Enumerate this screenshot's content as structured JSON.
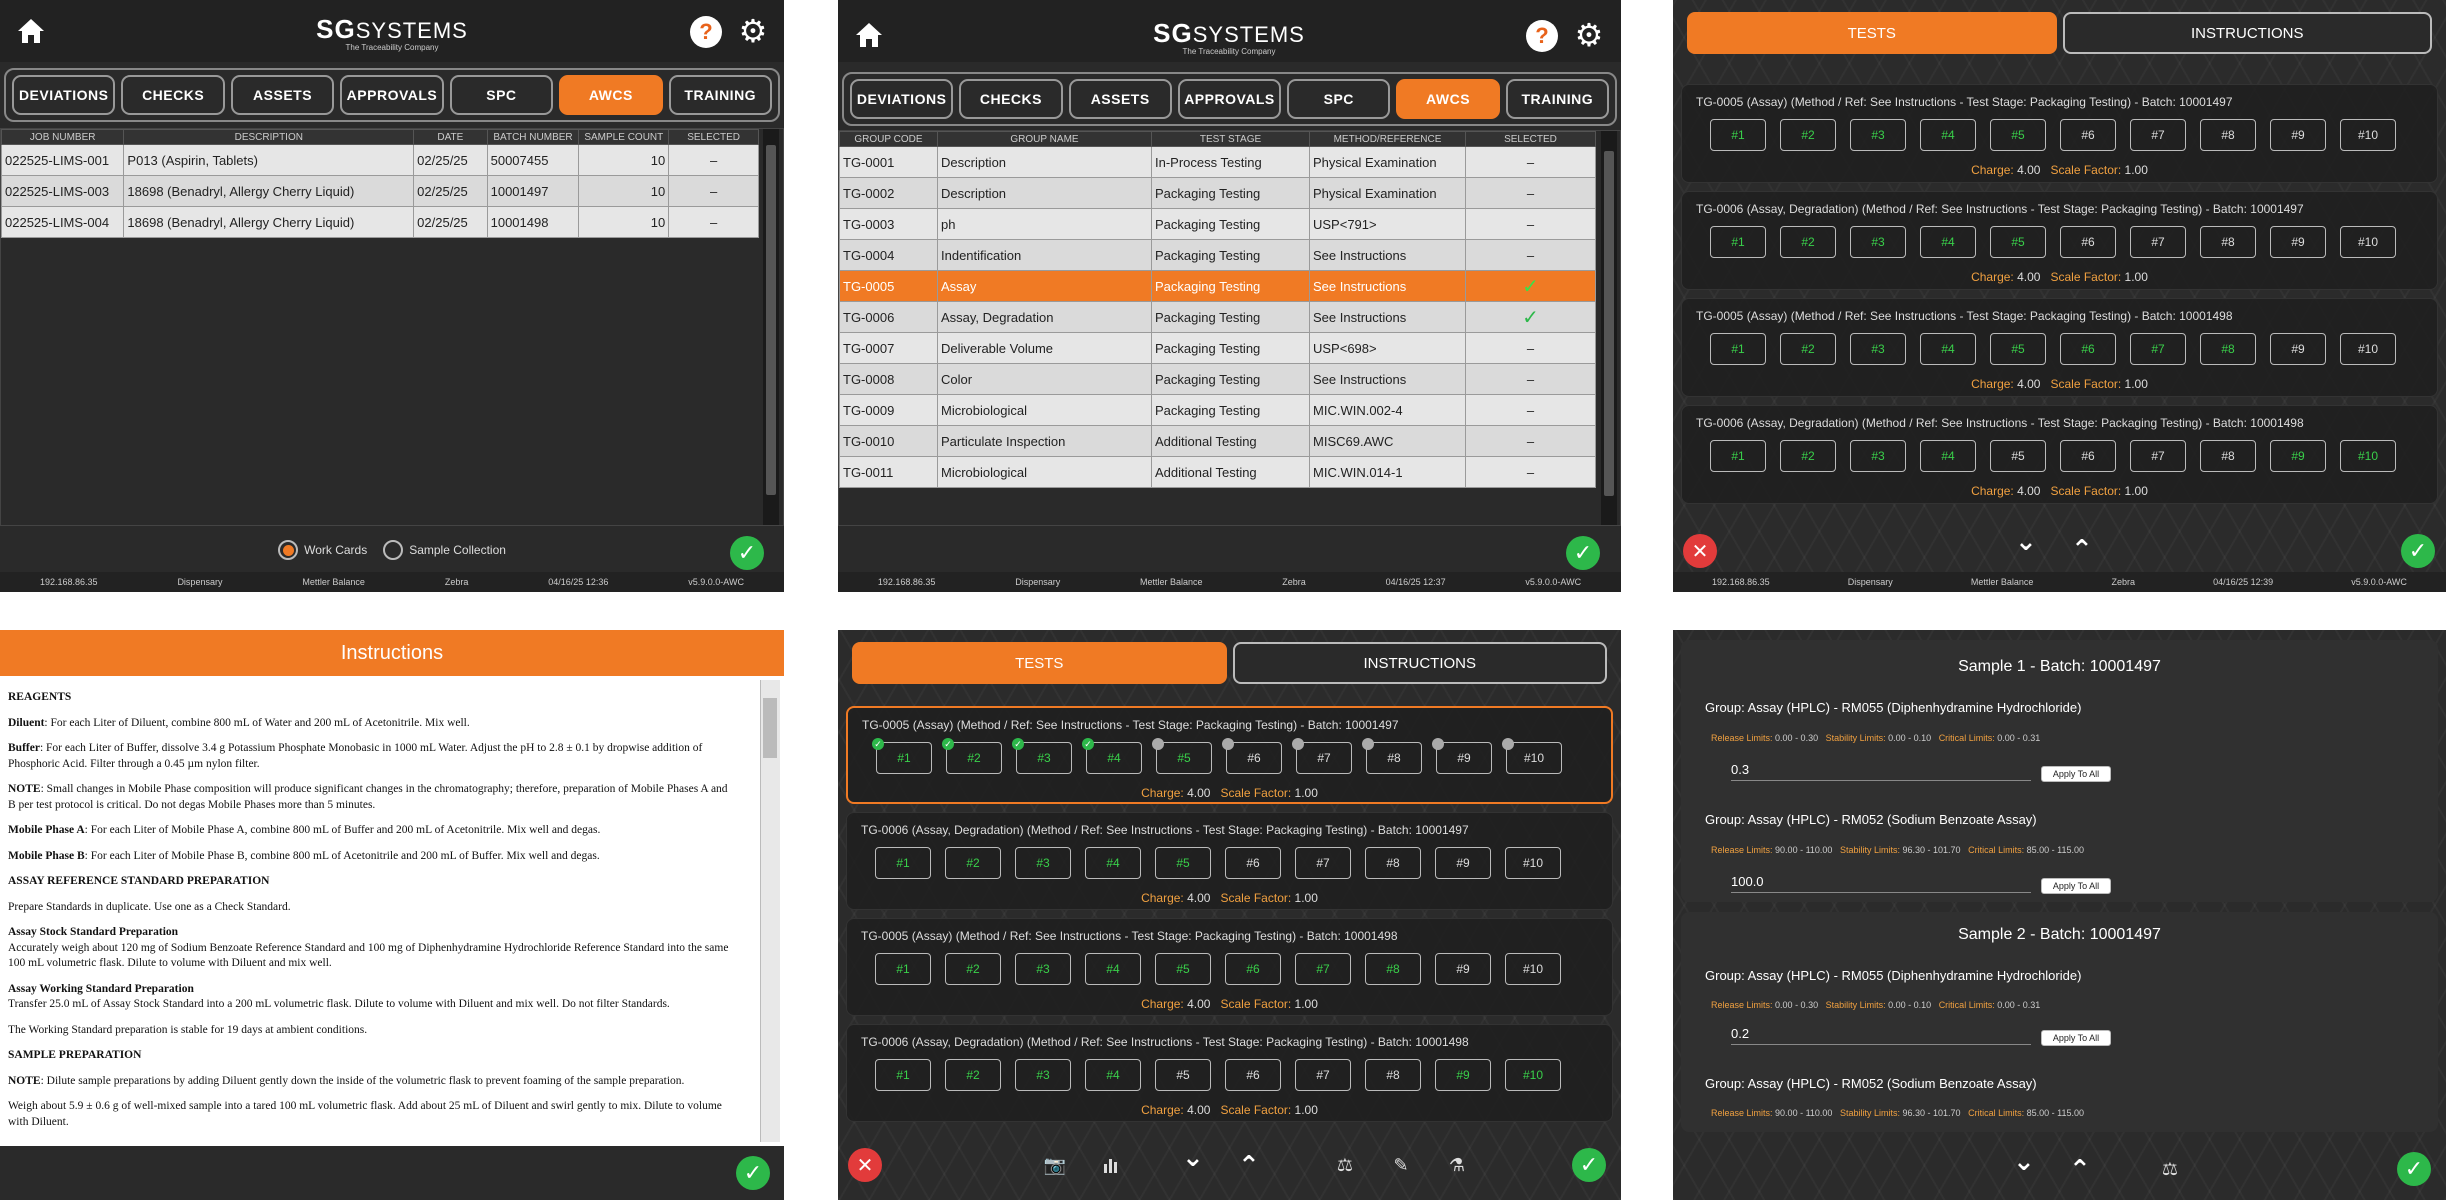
{
  "logo": {
    "mark": "SG",
    "name": "SYSTEMS",
    "tagline": "The Traceability Company"
  },
  "nav": [
    "DEVIATIONS",
    "CHECKS",
    "ASSETS",
    "APPROVALS",
    "SPC",
    "AWCS",
    "TRAINING"
  ],
  "status1": [
    "192.168.86.35",
    "Dispensary",
    "Mettler Balance",
    "Zebra",
    "04/16/25 12:36",
    "v5.9.0.0-AWC"
  ],
  "status2": [
    "192.168.86.35",
    "Dispensary",
    "Mettler Balance",
    "Zebra",
    "04/16/25 12:37",
    "v5.9.0.0-AWC"
  ],
  "status3": [
    "192.168.86.35",
    "Dispensary",
    "Mettler Balance",
    "Zebra",
    "04/16/25 12:39",
    "v5.9.0.0-AWC"
  ],
  "jobs": {
    "headers": [
      "JOB NUMBER",
      "DESCRIPTION",
      "DATE",
      "BATCH NUMBER",
      "SAMPLE COUNT",
      "SELECTED"
    ],
    "rows": [
      [
        "022525-LIMS-001",
        "P013 (Aspirin, Tablets)",
        "02/25/25",
        "50007455",
        "10",
        "–"
      ],
      [
        "022525-LIMS-003",
        "18698 (Benadryl, Allergy Cherry Liquid)",
        "02/25/25",
        "10001497",
        "10",
        "–"
      ],
      [
        "022525-LIMS-004",
        "18698 (Benadryl, Allergy Cherry Liquid)",
        "02/25/25",
        "10001498",
        "10",
        "–"
      ]
    ]
  },
  "radios": {
    "work_cards": "Work Cards",
    "sample_collection": "Sample Collection"
  },
  "groups": {
    "headers": [
      "GROUP CODE",
      "GROUP NAME",
      "TEST STAGE",
      "METHOD/REFERENCE",
      "SELECTED"
    ],
    "rows": [
      [
        "TG-0001",
        "Description",
        "In-Process Testing",
        "Physical Examination",
        "–"
      ],
      [
        "TG-0002",
        "Description",
        "Packaging Testing",
        "Physical Examination",
        "–"
      ],
      [
        "TG-0003",
        "ph",
        "Packaging Testing",
        "USP<791>",
        "–"
      ],
      [
        "TG-0004",
        "Indentification",
        "Packaging Testing",
        "See Instructions",
        "–"
      ],
      [
        "TG-0005",
        "Assay",
        "Packaging Testing",
        "See Instructions",
        "✓"
      ],
      [
        "TG-0006",
        "Assay, Degradation",
        "Packaging Testing",
        "See Instructions",
        "✓"
      ],
      [
        "TG-0007",
        "Deliverable Volume",
        "Packaging Testing",
        "USP<698>",
        "–"
      ],
      [
        "TG-0008",
        "Color",
        "Packaging Testing",
        "See Instructions",
        "–"
      ],
      [
        "TG-0009",
        "Microbiological",
        "Packaging Testing",
        "MIC.WIN.002-4",
        "–"
      ],
      [
        "TG-0010",
        "Particulate Inspection",
        "Additional Testing",
        "MISC69.AWC",
        "–"
      ],
      [
        "TG-0011",
        "Microbiological",
        "Additional Testing",
        "MIC.WIN.014-1",
        "–"
      ]
    ]
  },
  "tabs": {
    "tests": "TESTS",
    "instructions": "INSTRUCTIONS"
  },
  "sample_labels": [
    "#1",
    "#2",
    "#3",
    "#4",
    "#5",
    "#6",
    "#7",
    "#8",
    "#9",
    "#10"
  ],
  "charge_label": "Charge:",
  "scale_label": "Scale Factor:",
  "cards3": [
    {
      "title": "TG-0005 (Assay) (Method / Ref: See Instructions - Test Stage: Packaging Testing) - Batch: 10001497",
      "done": 5,
      "charge": "4.00",
      "scale": "1.00"
    },
    {
      "title": "TG-0006 (Assay, Degradation) (Method / Ref: See Instructions - Test Stage: Packaging Testing) - Batch: 10001497",
      "done": 5,
      "charge": "4.00",
      "scale": "1.00"
    },
    {
      "title": "TG-0005 (Assay) (Method / Ref: See Instructions - Test Stage: Packaging Testing) - Batch: 10001498",
      "done": 8,
      "charge": "4.00",
      "scale": "1.00"
    },
    {
      "title": "TG-0006 (Assay, Degradation) (Method / Ref: See Instructions - Test Stage: Packaging Testing) - Batch: 10001498",
      "done": 4,
      "extra": [
        8,
        9
      ],
      "charge": "4.00",
      "scale": "1.00"
    }
  ],
  "cards5": [
    {
      "title": "TG-0005 (Assay) (Method / Ref: See Instructions - Test Stage: Packaging Testing) - Batch: 10001497",
      "done": 5,
      "charge": "4.00",
      "scale": "1.00"
    },
    {
      "title": "TG-0006 (Assay, Degradation) (Method / Ref: See Instructions - Test Stage: Packaging Testing) - Batch: 10001497",
      "done": 5,
      "charge": "4.00",
      "scale": "1.00"
    },
    {
      "title": "TG-0005 (Assay) (Method / Ref: See Instructions - Test Stage: Packaging Testing) - Batch: 10001498",
      "done": 8,
      "charge": "4.00",
      "scale": "1.00"
    },
    {
      "title": "TG-0006 (Assay, Degradation) (Method / Ref: See Instructions - Test Stage: Packaging Testing) - Batch: 10001498",
      "done": 4,
      "extra": [
        8,
        9
      ],
      "charge": "4.00",
      "scale": "1.00"
    }
  ],
  "instructions": {
    "title": "Instructions",
    "h_reagents": "REAGENTS",
    "diluent_k": "Diluent",
    "diluent_v": ": For each Liter of Diluent, combine 800 mL of Water and 200 mL of Acetonitrile. Mix well.",
    "buffer_k": "Buffer",
    "buffer_v": ": For each Liter of Buffer, dissolve 3.4 g Potassium Phosphate Monobasic in 1000 mL Water. Adjust the pH to 2.8 ± 0.1 by dropwise addition of Phosphoric Acid. Filter through a 0.45 µm nylon filter.",
    "note_k": "NOTE",
    "note_v": ": Small changes in Mobile Phase composition will produce significant changes in the chromatography; therefore, preparation of Mobile Phases A and B per test protocol is critical. Do not degas Mobile Phases more than 5 minutes.",
    "mpa_k": "Mobile Phase A",
    "mpa_v": ": For each Liter of Mobile Phase A, combine 800 mL of Buffer and 200 mL of Acetonitrile. Mix well and degas.",
    "mpb_k": "Mobile Phase B",
    "mpb_v": ": For each Liter of Mobile Phase B, combine 800 mL of Acetonitrile and 200 mL of Buffer. Mix well and degas.",
    "h_assay": "ASSAY REFERENCE STANDARD PREPARATION",
    "dup": "Prepare Standards in duplicate. Use one as a Check Standard.",
    "stock_k": "Assay Stock Standard Preparation",
    "stock_v": "Accurately weigh about 120 mg of Sodium Benzoate Reference Standard and 100 mg of Diphenhydramine Hydrochloride Reference Standard into the same 100 mL volumetric flask. Dilute to volume with Diluent and mix well.",
    "work_k": "Assay Working Standard Preparation",
    "work_v": "Transfer 25.0 mL of Assay Stock Standard into a 200 mL volumetric flask. Dilute to volume with Diluent and mix well. Do not filter Standards.",
    "stable": "The Working Standard preparation is stable for 19 days at ambient conditions.",
    "h_sample": "SAMPLE PREPARATION",
    "note2_k": "NOTE",
    "note2_v": ": Dilute sample preparations by adding Diluent gently down the inside of the volumetric flask to prevent foaming of the sample preparation.",
    "weigh": "Weigh about 5.9 ± 0.6 g of well-mixed sample into a tared 100 mL volumetric flask. Add about 25 mL of Diluent and swirl gently to mix. Dilute to volume with Diluent."
  },
  "results": {
    "s1": "Sample 1 - Batch: 10001497",
    "s2": "Sample 2 - Batch: 10001497",
    "g_rm055": "Group: Assay (HPLC) - RM055 (Diphenhydramine Hydrochloride)",
    "g_rm052": "Group: Assay (HPLC) - RM052 (Sodium Benzoate Assay)",
    "rel_k": "Release Limits:",
    "stab_k": "Stability Limits:",
    "crit_k": "Critical Limits:",
    "rm055_rel": "0.00 - 0.30",
    "rm055_stab": "0.00 - 0.10",
    "rm055_crit": "0.00 - 0.31",
    "rm052_rel": "90.00 - 110.00",
    "rm052_stab": "96.30 - 101.70",
    "rm052_crit": "85.00 - 115.00",
    "v1": "0.3",
    "v2": "100.0",
    "v3": "0.2",
    "apply": "Apply To All"
  }
}
